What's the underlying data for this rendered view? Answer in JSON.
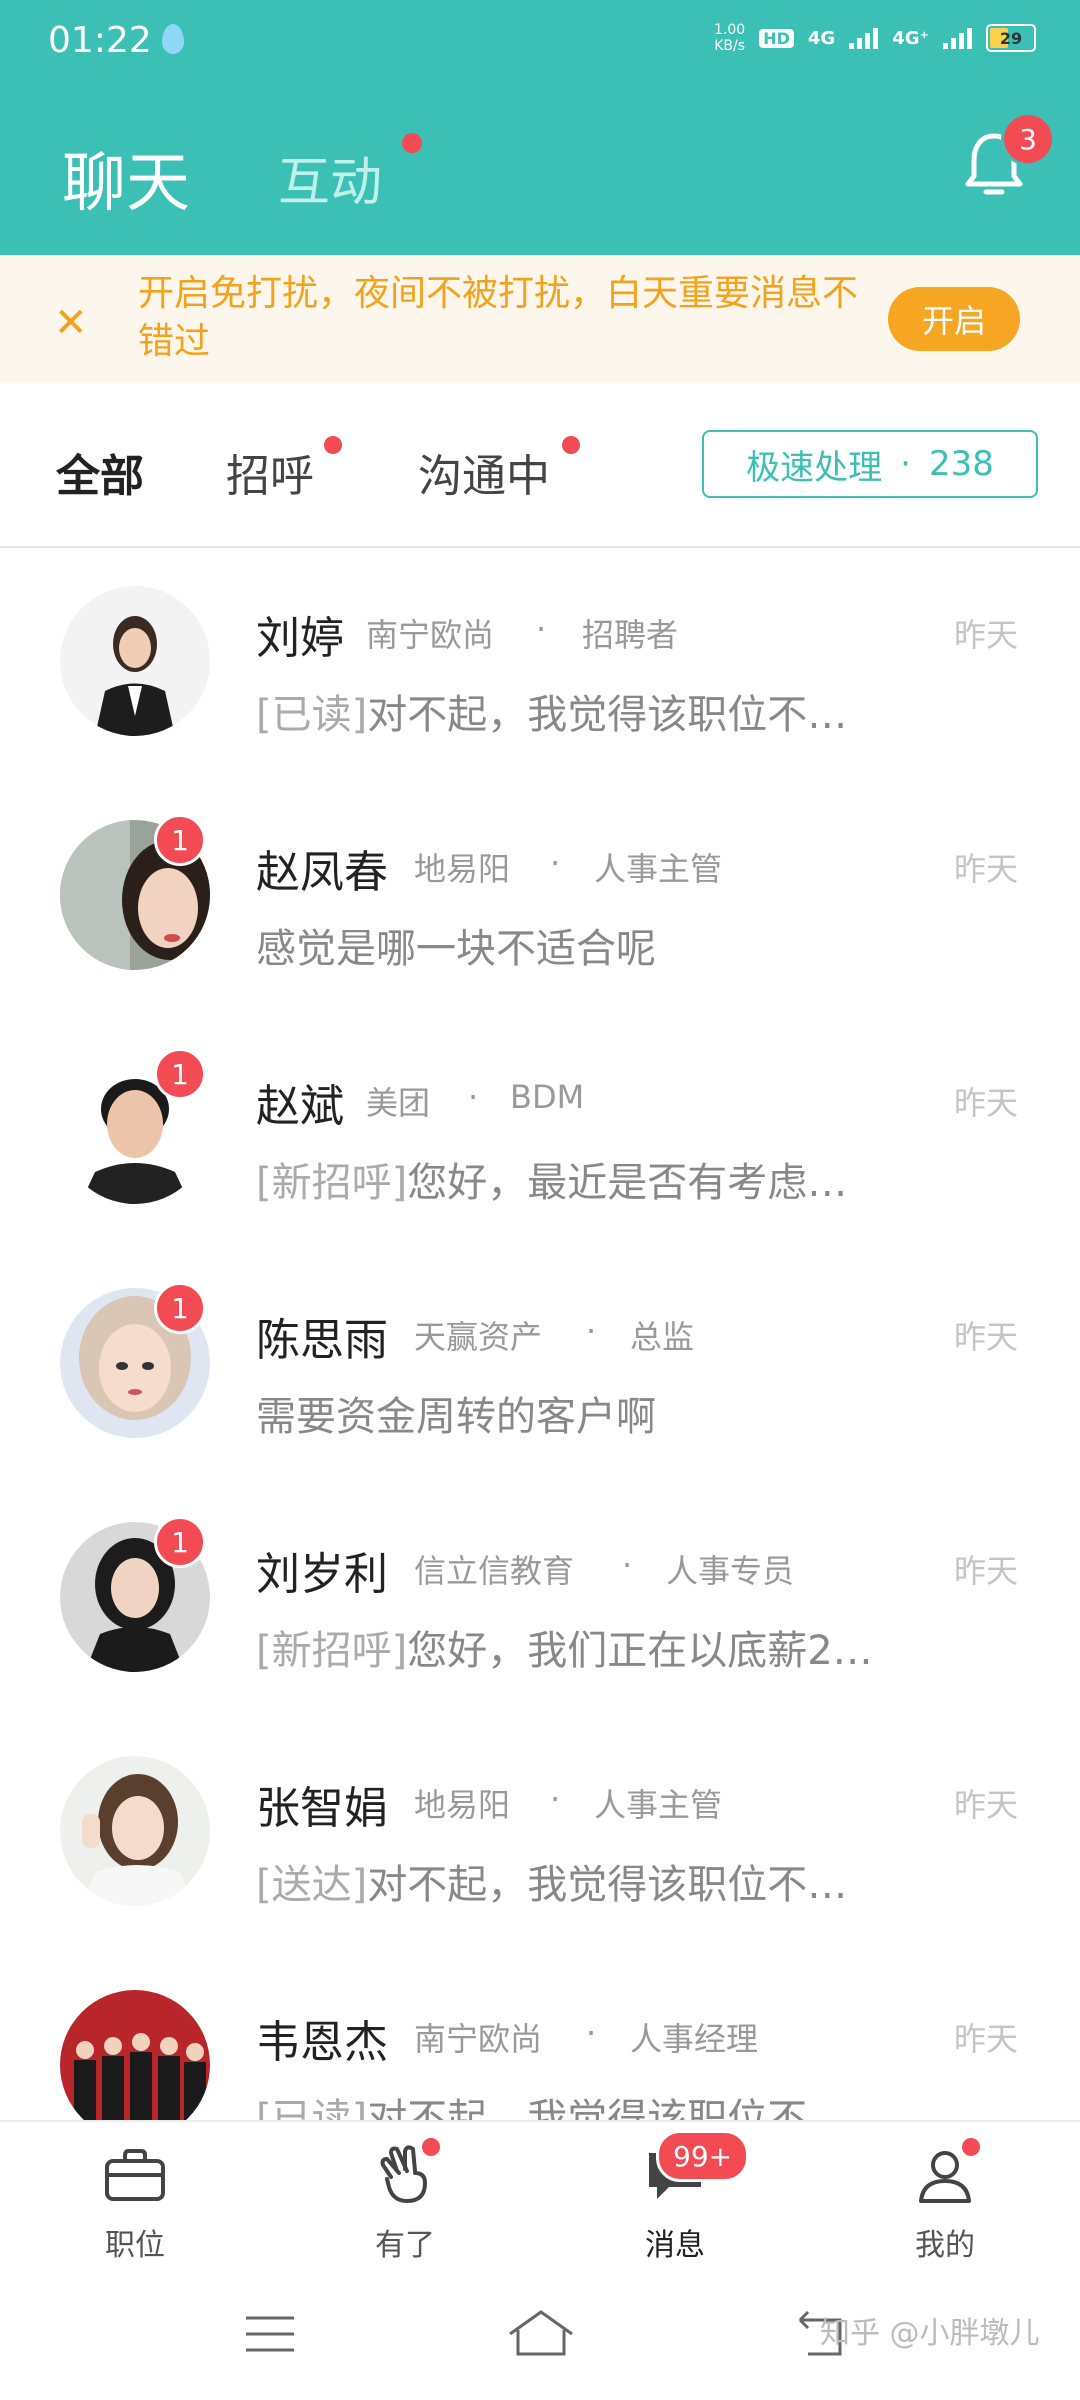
{
  "status_bar": {
    "time": "01:22",
    "speed": "1.00",
    "speed_unit": "KB/s",
    "hd": "HD",
    "network_1": "4G",
    "network_2": "4G⁺",
    "battery": "29"
  },
  "header": {
    "tab_chat": "聊天",
    "tab_interact": "互动",
    "bell_badge": "3"
  },
  "banner": {
    "text": "开启免打扰，夜间不被打扰，白天重要消息不错过",
    "button": "开启"
  },
  "filters": {
    "all": "全部",
    "greet": "招呼",
    "talking": "沟通中",
    "fast_label": "极速处理",
    "fast_dot": "·",
    "fast_count": "238"
  },
  "conversations": [
    {
      "name": "刘婷",
      "company": "南宁欧尚",
      "role": "招聘者",
      "date": "昨天",
      "tag": "[已读]",
      "message": "对不起，我觉得该职位不…",
      "badge": ""
    },
    {
      "name": "赵凤春",
      "company": "地易阳",
      "role": "人事主管",
      "date": "昨天",
      "tag": "",
      "message": "感觉是哪一块不适合呢",
      "badge": "1"
    },
    {
      "name": "赵斌",
      "company": "美团",
      "role": "BDM",
      "date": "昨天",
      "tag": "[新招呼]",
      "message": "您好，最近是否有考虑…",
      "badge": "1"
    },
    {
      "name": "陈思雨",
      "company": "天赢资产",
      "role": "总监",
      "date": "昨天",
      "tag": "",
      "message": "需要资金周转的客户啊",
      "badge": "1"
    },
    {
      "name": "刘岁利",
      "company": "信立信教育",
      "role": "人事专员",
      "date": "昨天",
      "tag": "[新招呼]",
      "message": "您好，我们正在以底薪2…",
      "badge": "1"
    },
    {
      "name": "张智娟",
      "company": "地易阳",
      "role": "人事主管",
      "date": "昨天",
      "tag": "[送达]",
      "message": "对不起，我觉得该职位不…",
      "badge": ""
    },
    {
      "name": "韦恩杰",
      "company": "南宁欧尚",
      "role": "人事经理",
      "date": "昨天",
      "tag": "[已读]",
      "message": "对不起，我觉得该职位不…",
      "badge": ""
    }
  ],
  "bottom_nav": {
    "jobs": "职位",
    "youle": "有了",
    "messages": "消息",
    "messages_badge": "99+",
    "mine": "我的"
  },
  "watermark": "知乎 @小胖墩儿",
  "colors": {
    "primary": "#3cc0b6",
    "accent_orange": "#f6a623",
    "badge_red": "#f24b54"
  }
}
